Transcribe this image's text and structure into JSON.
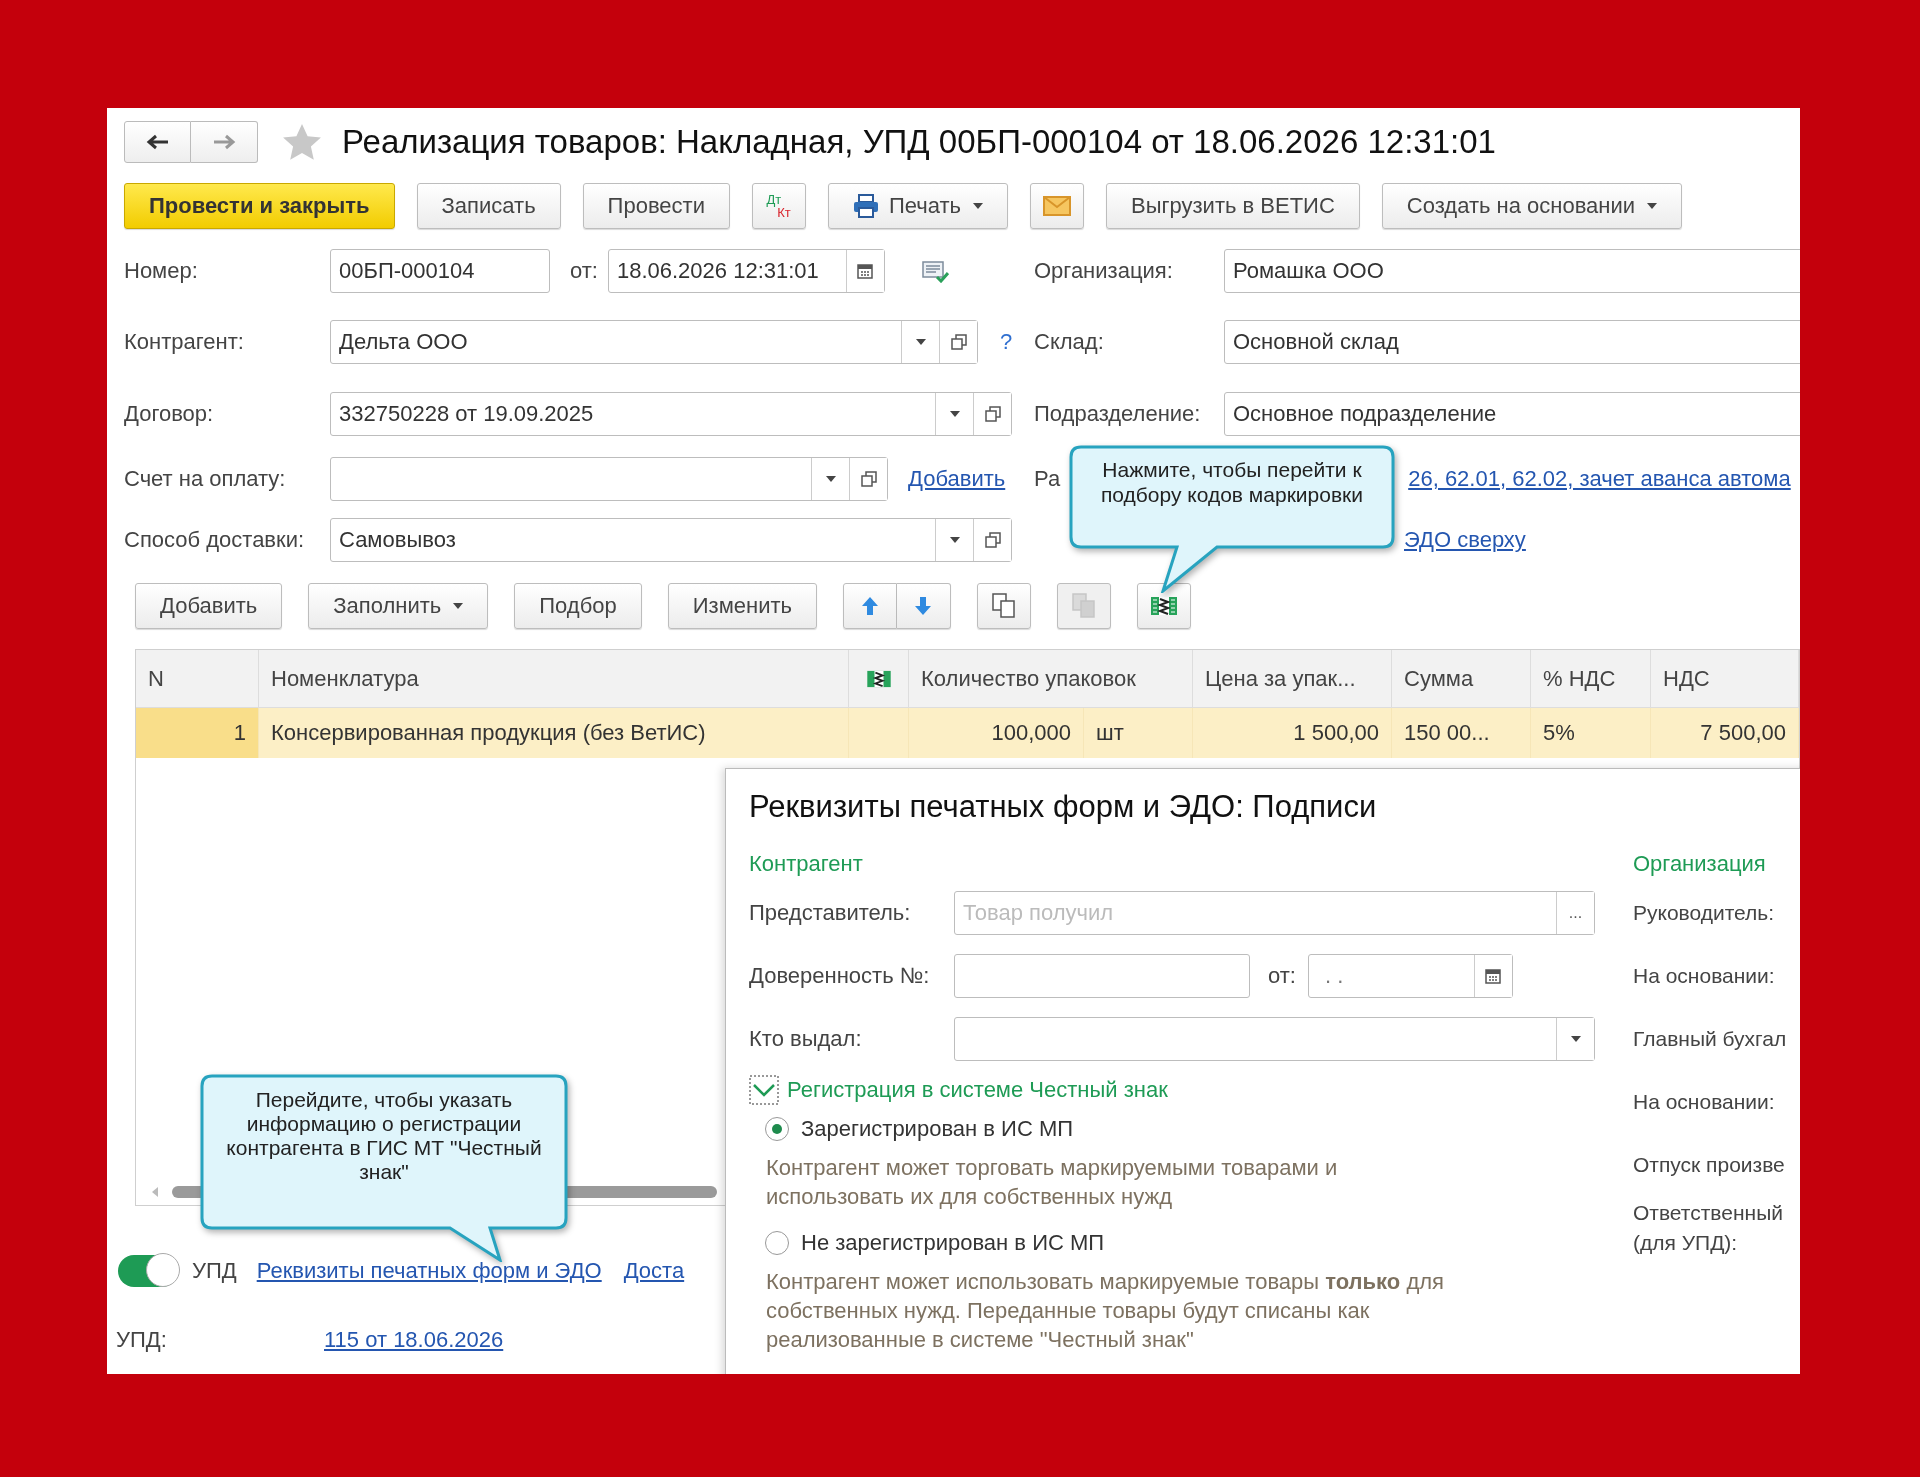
{
  "window": {
    "title": "Реализация товаров: Накладная, УПД 00БП-000104 от 18.06.2026 12:31:01"
  },
  "toolbar": [
    {
      "kind": "primary",
      "label": "Провести и закрыть"
    },
    {
      "kind": "button",
      "label": "Записать"
    },
    {
      "kind": "button",
      "label": "Провести"
    },
    {
      "kind": "dtkt",
      "top": "Дт",
      "bottom": "Кт"
    },
    {
      "kind": "print",
      "label": "Печать"
    },
    {
      "kind": "mail"
    },
    {
      "kind": "button",
      "label": "Выгрузить в ВЕТИС"
    },
    {
      "kind": "dropdown",
      "label": "Создать на основании"
    }
  ],
  "header": {
    "number": {
      "label": "Номер:",
      "value": "00БП-000104"
    },
    "date": {
      "label": "от:",
      "value": "18.06.2026 12:31:01"
    },
    "counterparty": {
      "label": "Контрагент:",
      "value": "Дельта ООО",
      "help": "?"
    },
    "contract": {
      "label": "Договор:",
      "value": "332750228 от 19.09.2025"
    },
    "invoice": {
      "label": "Счет на оплату:",
      "link": "Добавить"
    },
    "delivery": {
      "label": "Способ доставки:",
      "value": "Самовывоз"
    },
    "organization": {
      "label": "Организация:",
      "value": "Ромашка ООО"
    },
    "warehouse": {
      "label": "Склад:",
      "value": "Основной склад"
    },
    "department": {
      "label": "Подразделение:",
      "value": "Основное подразделение"
    },
    "settlements": {
      "label": "Ра",
      "link": "26, 62.01, 62.02, зачет аванса автома"
    },
    "edo_link": "ЭДО сверху"
  },
  "table_toolbar": [
    {
      "kind": "button",
      "label": "Добавить",
      "disabled": false
    },
    {
      "kind": "dropdown",
      "label": "Заполнить",
      "disabled": false
    },
    {
      "kind": "button",
      "label": "Подбор",
      "disabled": false
    },
    {
      "kind": "button",
      "label": "Изменить",
      "disabled": false
    },
    {
      "kind": "updown",
      "disabled": false
    },
    {
      "kind": "copy",
      "disabled": false
    },
    {
      "kind": "paste",
      "disabled": true
    },
    {
      "kind": "marking",
      "disabled": false
    }
  ],
  "table": {
    "columns": [
      {
        "kind": "text",
        "label": "N"
      },
      {
        "kind": "text",
        "label": "Номенклатура"
      },
      {
        "kind": "icon"
      },
      {
        "kind": "text",
        "label": "Количество упаковок"
      },
      {
        "kind": "text",
        "label": "Цена за упак..."
      },
      {
        "kind": "text",
        "label": "Сумма"
      },
      {
        "kind": "text",
        "label": "% НДС"
      },
      {
        "kind": "text",
        "label": "НДС"
      }
    ],
    "rows": [
      {
        "selected": true,
        "n": "1",
        "item": "Консервированная продукция (без ВетИС)",
        "qty": "100,000",
        "unit": "шт",
        "price": "1 500,00",
        "sum": "150 00...",
        "vat_rate": "5%",
        "vat": "7 500,00"
      }
    ]
  },
  "footer": {
    "toggle": {
      "on": true
    },
    "toggle_label": "УПД",
    "links": [
      "Реквизиты печатных форм и ЭДО",
      "Доста"
    ],
    "upd_label": "УПД:",
    "upd_link": "115 от 18.06.2026"
  },
  "popup": {
    "title": "Реквизиты печатных форм и ЭДО: Подписи",
    "left_heading": "Контрагент",
    "representative": {
      "label": "Представитель:",
      "placeholder": "Товар получил",
      "button": "..."
    },
    "poa": {
      "label": "Доверенность №:",
      "date_label": "от:",
      "date_value": ". ."
    },
    "issued_by": {
      "label": "Кто выдал:"
    },
    "registration": {
      "title": "Регистрация в системе Честный знак",
      "expanded": true,
      "options": [
        {
          "label": "Зарегистрирован в ИС МП",
          "selected": true,
          "description": "Контрагент может торговать маркируемыми товарами и использовать их для собственных нужд"
        },
        {
          "label": "Не зарегистрирован в ИС МП",
          "selected": false,
          "description": "Контрагент может использовать маркируемые товары **только** для собственных нужд. Переданные товары будут списаны как реализованные в системе \"Честный знак\""
        }
      ]
    },
    "right_heading": "Организация",
    "right_labels": [
      "Руководитель:",
      "На основании:",
      "Главный бухгал",
      "На основании:",
      "Отпуск произве",
      "Ответственный (для УПД):"
    ]
  },
  "callouts": [
    {
      "text": "Нажмите, чтобы перейти к подбору кодов маркировки"
    },
    {
      "text": "Перейдите, чтобы указать информацию о регистрации контрагента в ГИС МТ \"Честный знак\""
    }
  ]
}
